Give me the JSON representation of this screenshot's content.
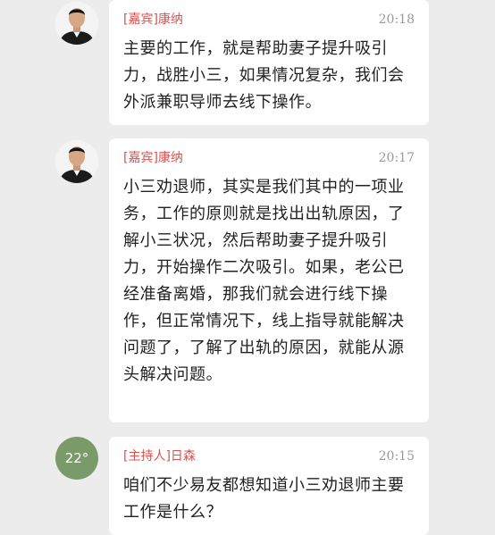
{
  "messages": [
    {
      "sender": "[嘉宾]康纳",
      "time": "20:18",
      "avatar": "person-photo-icon",
      "text": "主要的工作，就是帮助妻子提升吸引力，战胜小三，如果情况复杂，我们会外派兼职导师去线下操作。"
    },
    {
      "sender": "[嘉宾]康纳",
      "time": "20:17",
      "avatar": "person-photo-icon",
      "text": "小三劝退师，其实是我们其中的一项业务，工作的原则就是找出出轨原因，了解小三状况，然后帮助妻子提升吸引力，开始操作二次吸引。如果，老公已经准备离婚，那我们就会进行线下操作，但正常情况下，线上指导就能解决问题了，了解了出轨的原因，就能从源头解决问题。"
    },
    {
      "sender": "[主持人]日森",
      "time": "20:15",
      "avatar_text": "22°",
      "avatar_color": "#7b9a6a",
      "text": "咱们不少易友都想知道小三劝退师主要工作是什么？"
    }
  ]
}
